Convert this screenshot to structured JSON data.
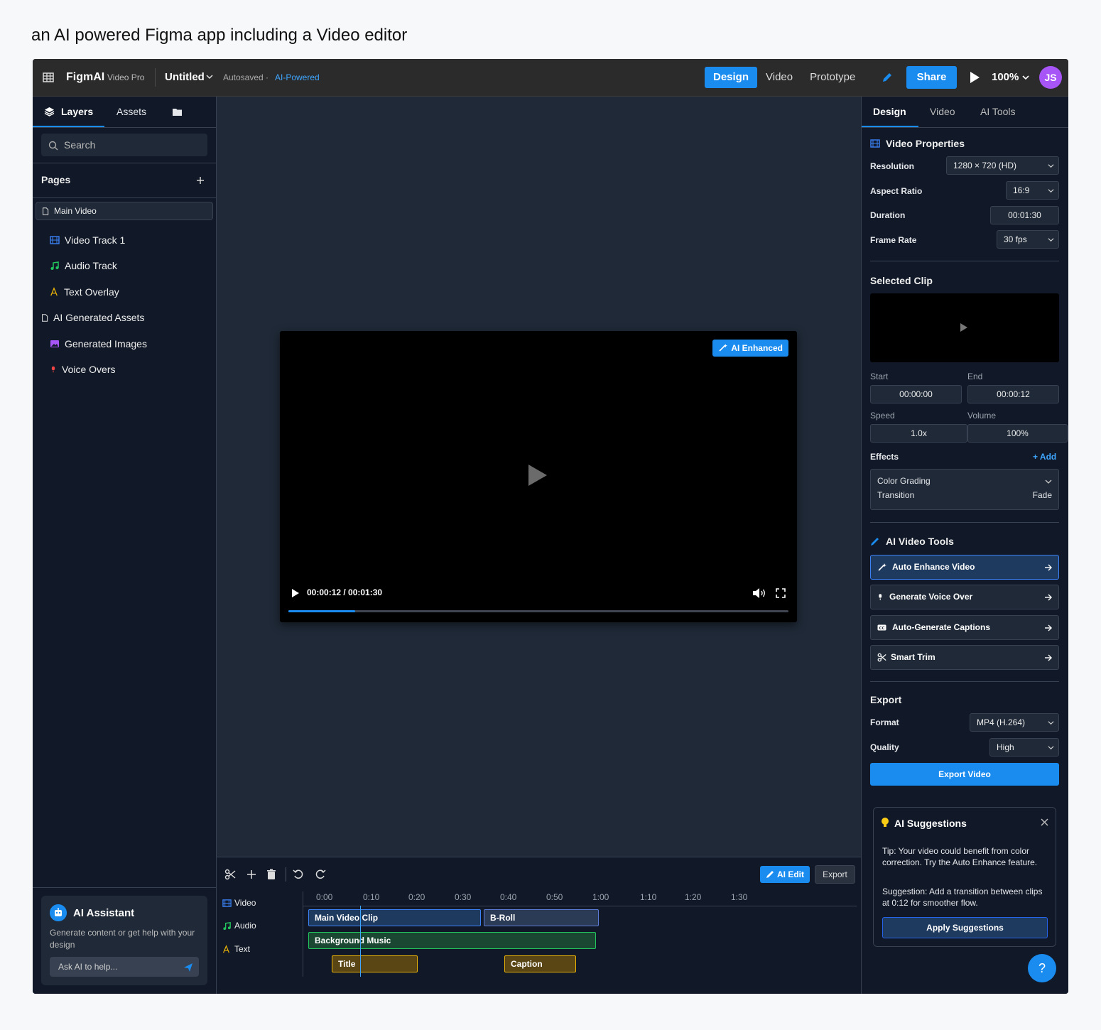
{
  "caption": "an AI powered Figma app including a Video editor",
  "topbar": {
    "brand": "FigmAI",
    "brand_sub": "Video Pro",
    "file_name": "Untitled",
    "autosaved": "Autosaved ·",
    "ai_powered": "AI-Powered",
    "modes": [
      "Design",
      "Video",
      "Prototype"
    ],
    "active_mode": "Design",
    "share_label": "Share",
    "zoom": "100%",
    "avatar_initials": "JS",
    "avatar_color": "#a855f7",
    "accent_color": "#1a8cf0"
  },
  "left_panel": {
    "tabs": [
      "Layers",
      "Assets"
    ],
    "active_tab": "Layers",
    "search_placeholder": "Search",
    "pages_title": "Pages",
    "tree": [
      {
        "label": "Main Video",
        "icon": "page-icon",
        "level": 0,
        "selected": true
      },
      {
        "label": "Video Track 1",
        "icon": "film-icon",
        "level": 1
      },
      {
        "label": "Audio Track",
        "icon": "music-icon",
        "level": 1
      },
      {
        "label": "Text Overlay",
        "icon": "text-icon",
        "level": 1
      },
      {
        "label": "AI Generated Assets",
        "icon": "page-icon",
        "level": 0
      },
      {
        "label": "Generated Images",
        "icon": "image-icon",
        "level": 1
      },
      {
        "label": "Voice Overs",
        "icon": "mic-icon",
        "level": 1
      }
    ],
    "ai_assistant": {
      "title": "AI Assistant",
      "description": "Generate content or get help with your design",
      "input_placeholder": "Ask AI to help..."
    }
  },
  "canvas": {
    "badge": "AI Enhanced",
    "time": "00:00:12 / 00:01:30",
    "progress_fraction": 0.133
  },
  "timeline": {
    "ai_edit_label": "AI Edit",
    "export_label": "Export",
    "tracks": [
      "Video",
      "Audio",
      "Text"
    ],
    "ruler": [
      "0:00",
      "0:10",
      "0:20",
      "0:30",
      "0:40",
      "0:50",
      "1:00",
      "1:10",
      "1:20",
      "1:30"
    ],
    "clips": {
      "main_video": "Main Video Clip",
      "broll": "B-Roll",
      "music": "Background Music",
      "title": "Title",
      "caption": "Caption"
    }
  },
  "right_panel": {
    "tabs": [
      "Design",
      "Video",
      "AI Tools"
    ],
    "active_tab": "Design",
    "video_props": {
      "title": "Video Properties",
      "resolution_label": "Resolution",
      "resolution": "1280 × 720 (HD)",
      "aspect_label": "Aspect Ratio",
      "aspect": "16:9",
      "duration_label": "Duration",
      "duration": "00:01:30",
      "fps_label": "Frame Rate",
      "fps": "30 fps"
    },
    "selected_clip": {
      "title": "Selected Clip",
      "start_label": "Start",
      "start": "00:00:00",
      "end_label": "End",
      "end": "00:00:12",
      "speed_label": "Speed",
      "speed": "1.0x",
      "volume_label": "Volume",
      "volume": "100%",
      "effects_label": "Effects",
      "add_label": "+ Add",
      "effect_1": "Color Grading",
      "effect_2": "Transition",
      "effect_2_value": "Fade"
    },
    "ai_tools": {
      "title": "AI Video Tools",
      "items": [
        "Auto Enhance Video",
        "Generate Voice Over",
        "Auto-Generate Captions",
        "Smart Trim"
      ]
    },
    "export": {
      "title": "Export",
      "format_label": "Format",
      "format": "MP4 (H.264)",
      "quality_label": "Quality",
      "quality": "High",
      "button": "Export Video"
    },
    "suggestions": {
      "title": "AI Suggestions",
      "tip": "Tip: Your video could benefit from color correction. Try the Auto Enhance feature.",
      "suggestion": "Suggestion: Add a transition between clips at 0:12 for smoother flow.",
      "apply_label": "Apply Suggestions"
    },
    "help_label": "?"
  }
}
